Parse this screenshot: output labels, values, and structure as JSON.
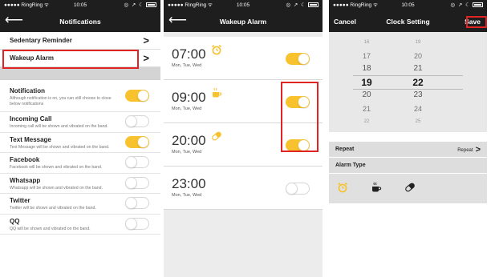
{
  "status_bar": {
    "carrier": "●●●●● RingRing ᯤ",
    "time": "10:05",
    "icons": "◎ ↗ ☾"
  },
  "notifications_screen": {
    "title": "Notifications",
    "back_icon": "back-arrow-icon",
    "menu": [
      {
        "label": "Sedentary Reminder",
        "chevron": ">"
      },
      {
        "label": "Wakeup Alarm",
        "chevron": ">"
      }
    ],
    "items": [
      {
        "title": "Notification",
        "desc": "Although notification is on, you can still choose to close below notifications",
        "on": true
      },
      {
        "title": "Incoming Call",
        "desc": "Incoming call will be shown and vibrated on the band.",
        "on": false
      },
      {
        "title": "Text Message",
        "desc": "Text Message will be shown and vibrated on the band.",
        "on": true
      },
      {
        "title": "Facebook",
        "desc": "Facebook will be shown and vibrated on the band.",
        "on": false
      },
      {
        "title": "Whatsapp",
        "desc": "Whatsapp will be shown and vibrated on the band.",
        "on": false
      },
      {
        "title": "Twitter",
        "desc": "Twitter will be shown and vibrated on the band.",
        "on": false
      },
      {
        "title": "QQ",
        "desc": "QQ will be shown and vibrated on the band.",
        "on": false
      }
    ]
  },
  "wakeup_alarm_screen": {
    "title": "Wakeup Alarm",
    "alarms": [
      {
        "time": "07:00",
        "days": "Mon, Tue, Wed",
        "icon": "alarm-clock-icon",
        "on": true
      },
      {
        "time": "09:00",
        "days": "Mon, Tue, Wed",
        "icon": "coffee-cup-icon",
        "on": true
      },
      {
        "time": "20:00",
        "days": "Mon, Tue, Wed",
        "icon": "pill-icon",
        "on": true
      },
      {
        "time": "23:00",
        "days": "Mon, Tue, Wed",
        "icon": "",
        "on": false
      }
    ]
  },
  "clock_setting_screen": {
    "title": "Clock Setting",
    "cancel": "Cancel",
    "save": "Save",
    "hours": [
      "16",
      "17",
      "18",
      "19",
      "20",
      "21",
      "22"
    ],
    "minutes": [
      "19",
      "20",
      "21",
      "22",
      "23",
      "24",
      "25"
    ],
    "selected_hour": "19",
    "selected_minute": "22",
    "repeat_label": "Repeat",
    "repeat_value": "Repeat",
    "repeat_chevron": ">",
    "alarm_type_label": "Alarm Type",
    "alarm_types": [
      "alarm-clock-icon",
      "coffee-cup-icon",
      "pill-icon"
    ]
  },
  "colors": {
    "accent": "#f7c22d",
    "header": "#1e1e1e",
    "highlight": "#e02424"
  }
}
